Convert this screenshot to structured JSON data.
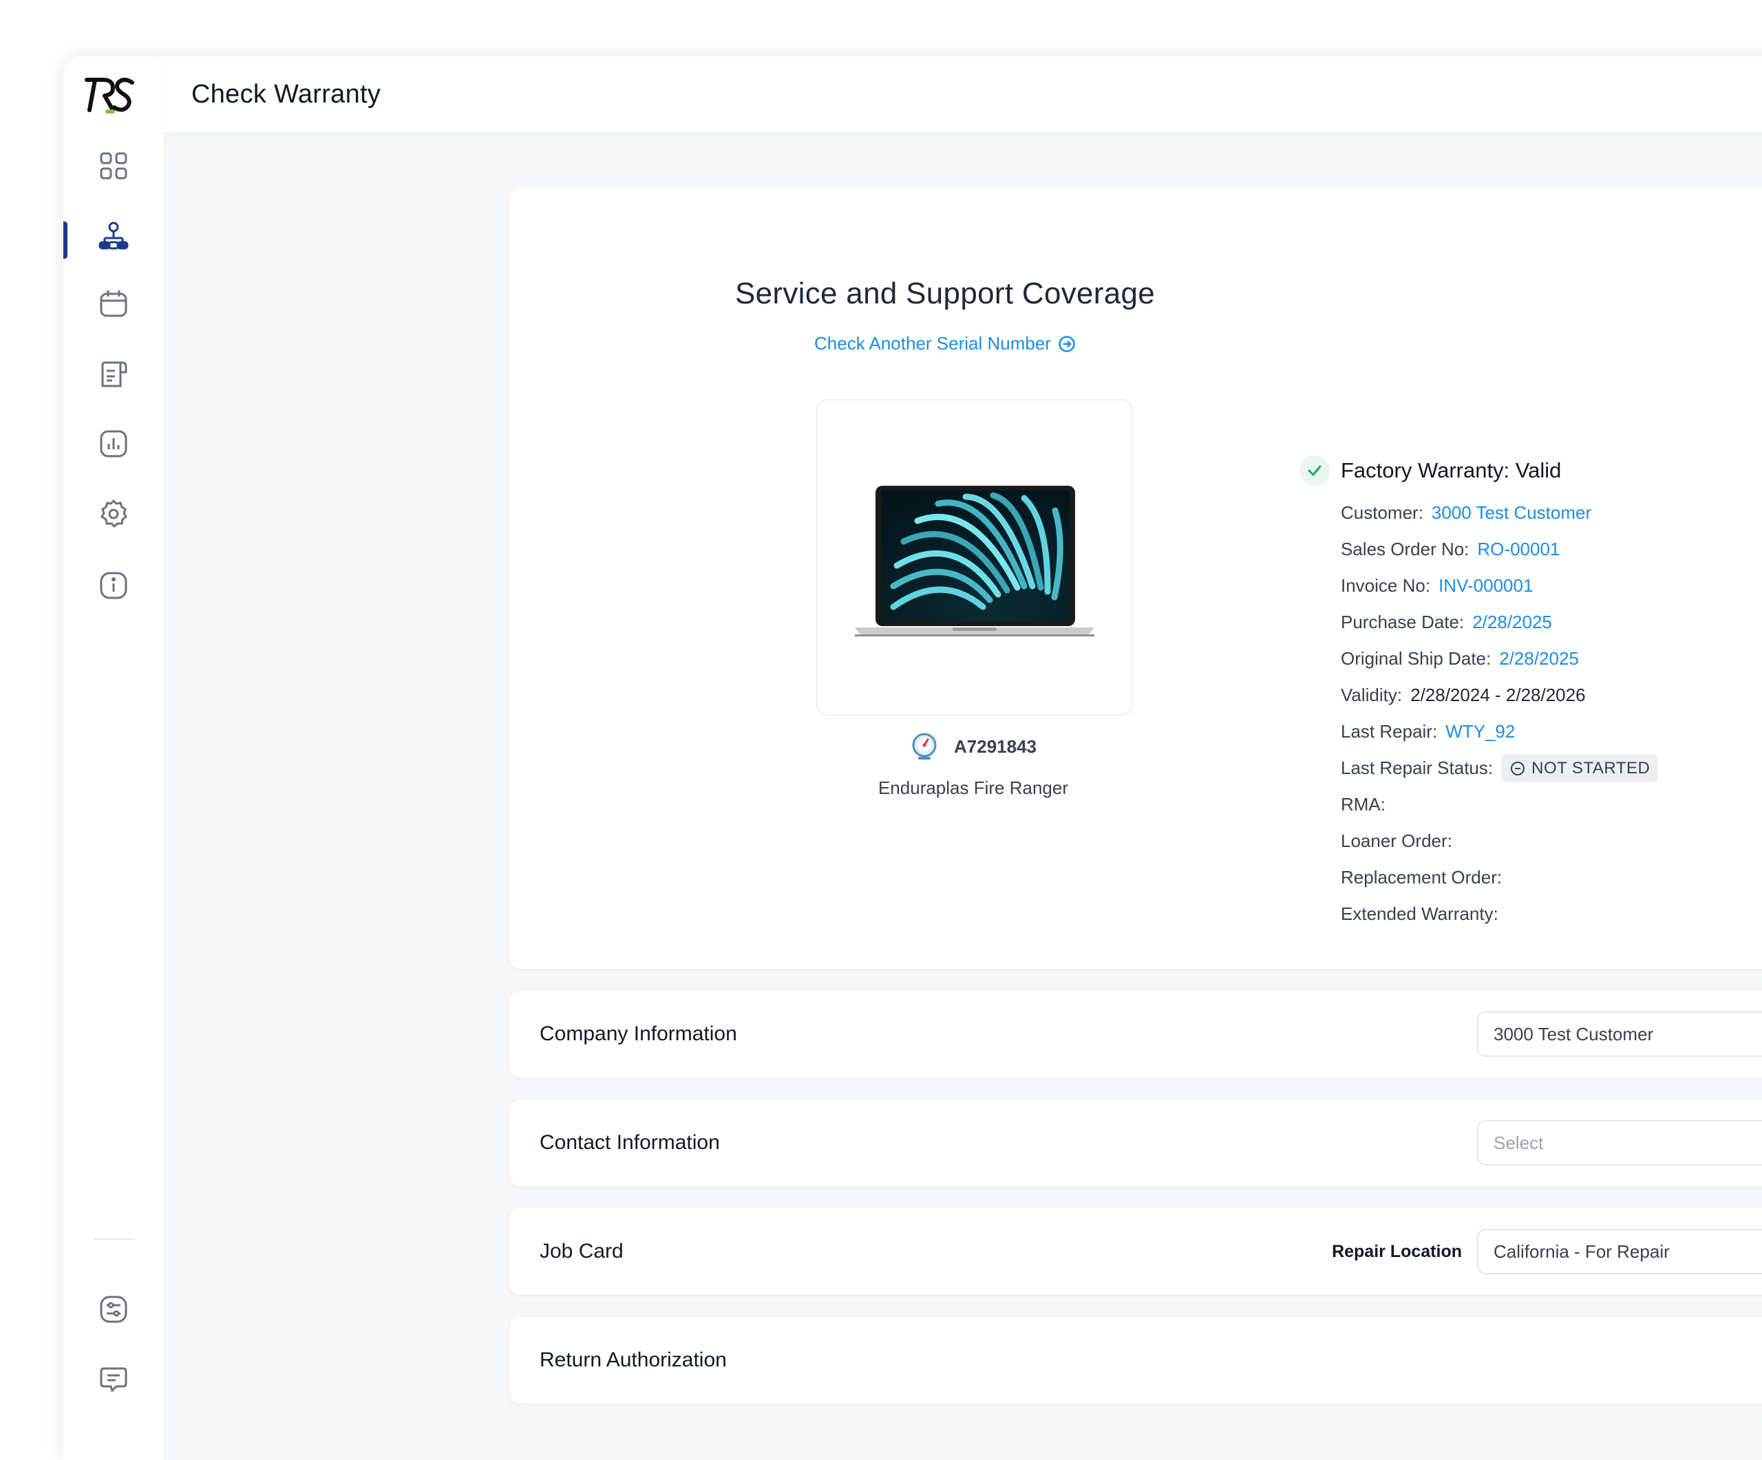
{
  "header": {
    "title": "Check Warranty"
  },
  "sidebar": {
    "logo_text": "RS",
    "items": [
      {
        "name": "dashboard",
        "icon": "grid-icon"
      },
      {
        "name": "customers",
        "icon": "org-chart-icon",
        "active": true
      },
      {
        "name": "calendar",
        "icon": "calendar-icon"
      },
      {
        "name": "documents",
        "icon": "document-icon"
      },
      {
        "name": "reports",
        "icon": "chart-icon"
      },
      {
        "name": "settings",
        "icon": "gear-icon"
      },
      {
        "name": "info",
        "icon": "info-icon"
      }
    ],
    "bottom_items": [
      {
        "name": "preferences",
        "icon": "sliders-icon"
      },
      {
        "name": "messages",
        "icon": "chat-icon"
      }
    ]
  },
  "coverage": {
    "title": "Service and Support Coverage",
    "check_another_link": "Check Another Serial Number",
    "product": {
      "serial": "A7291843",
      "name": "Enduraplas Fire Ranger"
    },
    "warranty_status": "Factory Warranty: Valid",
    "details": [
      {
        "label": "Customer:",
        "value": "3000 Test Customer",
        "link": true
      },
      {
        "label": "Sales Order No:",
        "value": "RO-00001",
        "link": true
      },
      {
        "label": "Invoice No:",
        "value": "INV-000001",
        "link": true
      },
      {
        "label": "Purchase Date:",
        "value": "2/28/2025",
        "link": true
      },
      {
        "label": "Original Ship Date:",
        "value": "2/28/2025",
        "link": true
      },
      {
        "label": "Validity:",
        "value": "2/28/2024 - 2/28/2026",
        "link": false
      },
      {
        "label": "Last Repair:",
        "value": "WTY_92",
        "link": true
      },
      {
        "label": "Last Repair Status:",
        "value": "NOT STARTED",
        "badge": true
      },
      {
        "label": "RMA:",
        "value": ""
      },
      {
        "label": "Loaner Order:",
        "value": ""
      },
      {
        "label": "Replacement Order:",
        "value": ""
      },
      {
        "label": "Extended Warranty:",
        "value": ""
      }
    ]
  },
  "sections": {
    "company": {
      "title": "Company Information",
      "value": "3000 Test Customer"
    },
    "contact": {
      "title": "Contact Information",
      "placeholder": "Select"
    },
    "job_card": {
      "title": "Job Card",
      "field_label": "Repair Location",
      "value": "California - For Repair"
    },
    "return_auth": {
      "title": "Return Authorization"
    }
  },
  "colors": {
    "link": "#1d8ce0",
    "active_nav": "#1e3a8a",
    "success": "#22a85a"
  }
}
